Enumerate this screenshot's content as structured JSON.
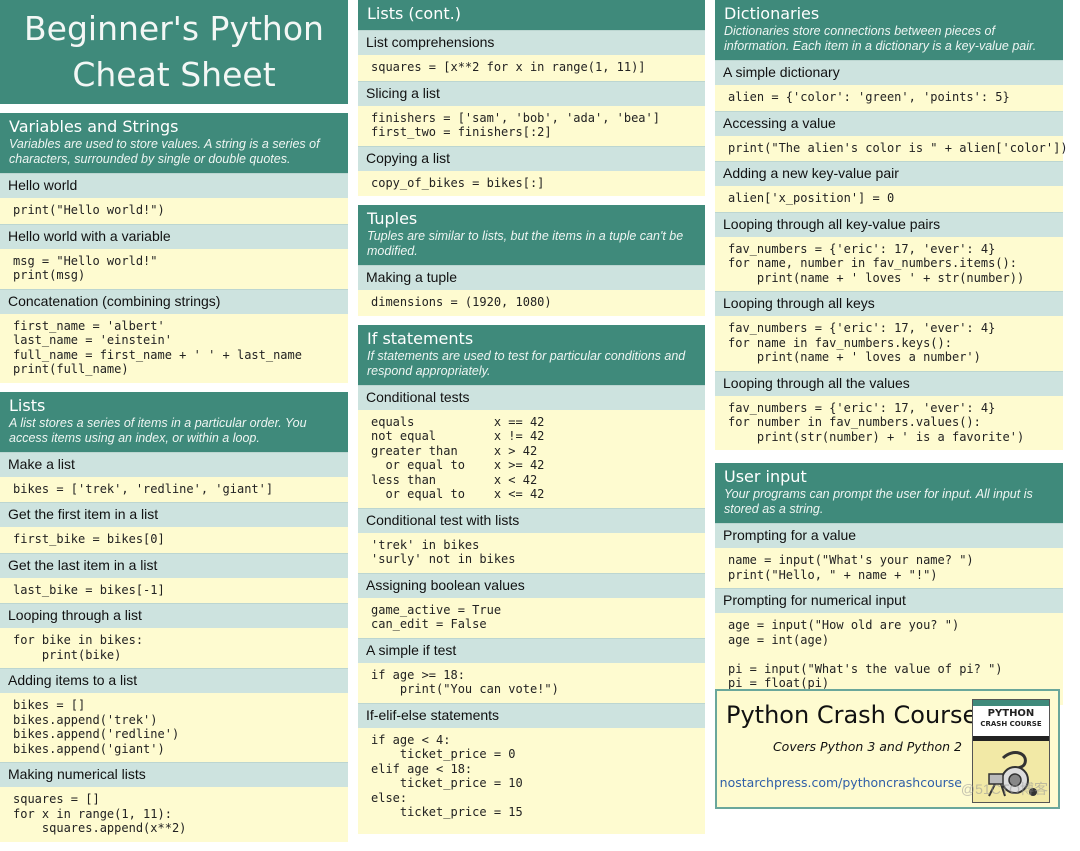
{
  "header": {
    "title_line1": "Beginner's Python",
    "title_line2": "Cheat Sheet"
  },
  "sections": {
    "variables": {
      "title": "Variables and Strings",
      "desc": "Variables are used to store values. A string is a series of characters, surrounded by single or double quotes.",
      "items": [
        {
          "label": "Hello world",
          "code": "print(\"Hello world!\")"
        },
        {
          "label": "Hello world with a variable",
          "code": "msg = \"Hello world!\"\nprint(msg)"
        },
        {
          "label": "Concatenation (combining strings)",
          "code": "first_name = 'albert'\nlast_name = 'einstein'\nfull_name = first_name + ' ' + last_name\nprint(full_name)"
        }
      ]
    },
    "lists": {
      "title": "Lists",
      "desc": "A list stores a series of items in a particular order. You access items using an index, or within a loop.",
      "items": [
        {
          "label": "Make a list",
          "code": "bikes = ['trek', 'redline', 'giant']"
        },
        {
          "label": "Get the first item in a list",
          "code": "first_bike = bikes[0]"
        },
        {
          "label": "Get the last item in a list",
          "code": "last_bike = bikes[-1]"
        },
        {
          "label": "Looping through a list",
          "code": "for bike in bikes:\n    print(bike)"
        },
        {
          "label": "Adding items to a list",
          "code": "bikes = []\nbikes.append('trek')\nbikes.append('redline')\nbikes.append('giant')"
        },
        {
          "label": "Making numerical lists",
          "code": "squares = []\nfor x in range(1, 11):\n    squares.append(x**2)"
        }
      ]
    },
    "lists_cont": {
      "title": "Lists (cont.)",
      "items": [
        {
          "label": "List comprehensions",
          "code": "squares = [x**2 for x in range(1, 11)]"
        },
        {
          "label": "Slicing a list",
          "code": "finishers = ['sam', 'bob', 'ada', 'bea']\nfirst_two = finishers[:2]"
        },
        {
          "label": "Copying a list",
          "code": "copy_of_bikes = bikes[:]"
        }
      ]
    },
    "tuples": {
      "title": "Tuples",
      "desc": "Tuples are similar to lists, but the items in a tuple can't be modified.",
      "items": [
        {
          "label": "Making a tuple",
          "code": "dimensions = (1920, 1080)"
        }
      ]
    },
    "if_statements": {
      "title": "If statements",
      "desc": "If statements are used to test for particular conditions and respond appropriately.",
      "items": [
        {
          "label": "Conditional tests",
          "code": "equals           x == 42\nnot equal        x != 42\ngreater than     x > 42\n  or equal to    x >= 42\nless than        x < 42\n  or equal to    x <= 42"
        },
        {
          "label": "Conditional test with lists",
          "code": "'trek' in bikes\n'surly' not in bikes"
        },
        {
          "label": "Assigning boolean values",
          "code": "game_active = True\ncan_edit = False"
        },
        {
          "label": "A simple if test",
          "code": "if age >= 18:\n    print(\"You can vote!\")"
        },
        {
          "label": "If-elif-else statements",
          "code": "if age < 4:\n    ticket_price = 0\nelif age < 18:\n    ticket_price = 10\nelse:\n    ticket_price = 15"
        }
      ]
    },
    "dictionaries": {
      "title": "Dictionaries",
      "desc": "Dictionaries store connections between pieces of information. Each item in a dictionary is a key-value pair.",
      "items": [
        {
          "label": "A simple dictionary",
          "code": "alien = {'color': 'green', 'points': 5}"
        },
        {
          "label": "Accessing a value",
          "code": "print(\"The alien's color is \" + alien['color'])"
        },
        {
          "label": "Adding a new key-value pair",
          "code": "alien['x_position'] = 0"
        },
        {
          "label": "Looping through all key-value pairs",
          "code": "fav_numbers = {'eric': 17, 'ever': 4}\nfor name, number in fav_numbers.items():\n    print(name + ' loves ' + str(number))"
        },
        {
          "label": "Looping through all keys",
          "code": "fav_numbers = {'eric': 17, 'ever': 4}\nfor name in fav_numbers.keys():\n    print(name + ' loves a number')"
        },
        {
          "label": "Looping through all the values",
          "code": "fav_numbers = {'eric': 17, 'ever': 4}\nfor number in fav_numbers.values():\n    print(str(number) + ' is a favorite')"
        }
      ]
    },
    "user_input": {
      "title": "User input",
      "desc": "Your programs can prompt the user for input. All input is stored as a string.",
      "items": [
        {
          "label": "Prompting for a value",
          "code": "name = input(\"What's your name? \")\nprint(\"Hello, \" + name + \"!\")"
        },
        {
          "label": "Prompting for numerical input",
          "code": "age = input(\"How old are you? \")\nage = int(age)\n\npi = input(\"What's the value of pi? \")\npi = float(pi)"
        }
      ]
    }
  },
  "promo": {
    "title": "Python Crash Course",
    "subtitle": "Covers Python 3 and Python 2",
    "link": "nostarchpress.com/pythoncrashcourse",
    "cover_title1": "PYTHON",
    "cover_title2": "CRASH COURSE"
  },
  "watermark": "@51CTO博客",
  "colors": {
    "header": "#3f8a7b",
    "subheader": "#cde3df",
    "code_bg": "#fefbd0",
    "link": "#2f5fa8"
  }
}
